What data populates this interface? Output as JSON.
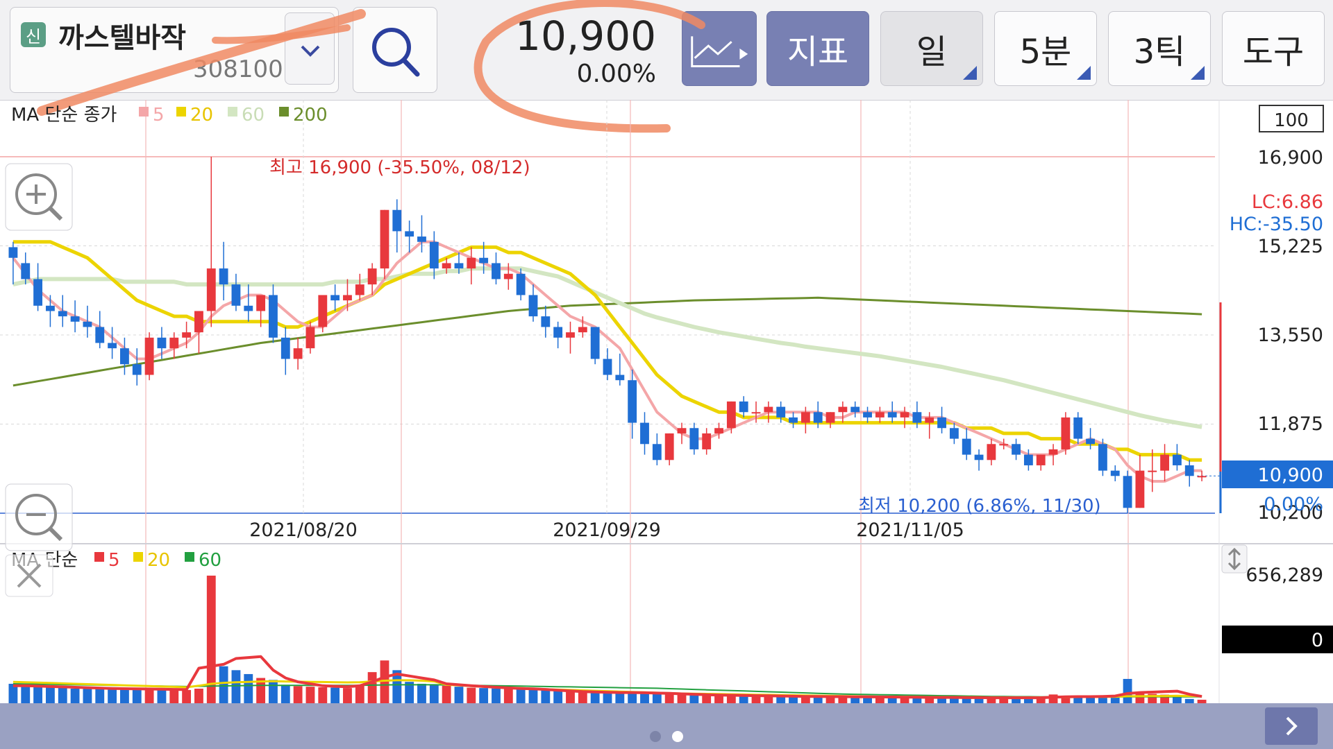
{
  "header": {
    "stock_badge": "신",
    "stock_name": "까스텔바작",
    "stock_code": "308100",
    "price": "10,900",
    "change_pct": "0.00%",
    "buttons": {
      "indicator": "지표",
      "day": "일",
      "min": "5분",
      "tick": "3틱",
      "tools": "도구"
    }
  },
  "colors": {
    "up": "#e8383d",
    "down": "#1f6ed4",
    "ma5": "#f4a6a8",
    "ma20": "#ecd400",
    "ma60": "#d3e6c2",
    "ma200": "#6b8e2c",
    "toolbar_blue": "#7880b3"
  },
  "price_panel": {
    "legend_prefix": "MA 단순 종가",
    "legend": [
      {
        "label": "5",
        "color": "#f4a6a8"
      },
      {
        "label": "20",
        "color": "#ecd400"
      },
      {
        "label": "60",
        "color": "#d3e6c2"
      },
      {
        "label": "200",
        "color": "#6b8e2c"
      }
    ],
    "zoom_box": "100",
    "lc": "LC:6.86",
    "hc": "HC:-35.50",
    "high_label": "최고 16,900 (-35.50%, 08/12)",
    "low_label": "최저 10,200 (6.86%, 11/30)",
    "last_price": "10,900",
    "last_pct": "0.00%",
    "y_labels": [
      "16,900",
      "15,225",
      "13,550",
      "11,875",
      "10,200"
    ],
    "x_labels": [
      "2021/08/20",
      "2021/09/29",
      "2021/11/05"
    ]
  },
  "volume_panel": {
    "legend_prefix": "MA 단순",
    "legend": [
      {
        "label": "5",
        "color": "#e8383d"
      },
      {
        "label": "20",
        "color": "#ecd400"
      },
      {
        "label": "60",
        "color": "#22a040"
      }
    ],
    "max_label": "656,289",
    "current": "0"
  },
  "icons": {
    "dropdown": "chevron-down-icon",
    "search": "search-icon",
    "chart_type": "line-chart-icon",
    "zoom_in": "zoom-in-icon",
    "zoom_out": "zoom-out-icon",
    "close": "close-icon",
    "resize": "resize-icon",
    "next": "chevron-right-icon"
  },
  "chart_data": {
    "type": "candlestick",
    "y_range": [
      10200,
      16900
    ],
    "candles_ohlc": [
      [
        15200,
        15300,
        14500,
        15000
      ],
      [
        14900,
        15100,
        14500,
        14600
      ],
      [
        14600,
        14900,
        14000,
        14100
      ],
      [
        14100,
        14300,
        13700,
        14000
      ],
      [
        14000,
        14300,
        13700,
        13900
      ],
      [
        13900,
        14200,
        13600,
        13800
      ],
      [
        13800,
        14100,
        13500,
        13700
      ],
      [
        13700,
        14000,
        13300,
        13400
      ],
      [
        13400,
        13700,
        13100,
        13300
      ],
      [
        13300,
        13500,
        12800,
        13000
      ],
      [
        13000,
        13300,
        12600,
        12800
      ],
      [
        12800,
        13600,
        12700,
        13500
      ],
      [
        13500,
        13700,
        13100,
        13300
      ],
      [
        13300,
        13600,
        13100,
        13500
      ],
      [
        13500,
        13800,
        13300,
        13600
      ],
      [
        13600,
        14000,
        13200,
        14000
      ],
      [
        14000,
        16900,
        13700,
        14800
      ],
      [
        14800,
        15300,
        14200,
        14500
      ],
      [
        14500,
        14700,
        14000,
        14100
      ],
      [
        14100,
        14500,
        13800,
        14000
      ],
      [
        14000,
        14300,
        13700,
        14300
      ],
      [
        14300,
        14500,
        13400,
        13500
      ],
      [
        13500,
        13700,
        12800,
        13100
      ],
      [
        13100,
        13500,
        12900,
        13300
      ],
      [
        13300,
        13800,
        13200,
        13700
      ],
      [
        13700,
        14200,
        13600,
        14300
      ],
      [
        14300,
        14500,
        14000,
        14200
      ],
      [
        14200,
        14600,
        14000,
        14300
      ],
      [
        14300,
        14700,
        14200,
        14500
      ],
      [
        14500,
        14900,
        14300,
        14800
      ],
      [
        14800,
        15900,
        14600,
        15900
      ],
      [
        15900,
        16100,
        15100,
        15500
      ],
      [
        15500,
        15700,
        15100,
        15400
      ],
      [
        15400,
        15800,
        15100,
        15300
      ],
      [
        15300,
        15500,
        14600,
        14800
      ],
      [
        14800,
        15000,
        14700,
        14900
      ],
      [
        14900,
        15100,
        14700,
        14800
      ],
      [
        14800,
        15200,
        14500,
        15000
      ],
      [
        15000,
        15300,
        14700,
        14900
      ],
      [
        14900,
        15100,
        14500,
        14600
      ],
      [
        14600,
        14900,
        14400,
        14700
      ],
      [
        14700,
        14800,
        14200,
        14300
      ],
      [
        14300,
        14500,
        13800,
        13900
      ],
      [
        13900,
        14100,
        13500,
        13700
      ],
      [
        13700,
        13800,
        13300,
        13500
      ],
      [
        13500,
        13800,
        13200,
        13600
      ],
      [
        13600,
        13900,
        13500,
        13700
      ],
      [
        13700,
        13700,
        13000,
        13100
      ],
      [
        13100,
        13300,
        12700,
        12800
      ],
      [
        12800,
        13200,
        12600,
        12700
      ],
      [
        12700,
        12900,
        11600,
        11900
      ],
      [
        11900,
        12100,
        11300,
        11500
      ],
      [
        11500,
        11700,
        11100,
        11200
      ],
      [
        11200,
        11700,
        11100,
        11700
      ],
      [
        11700,
        11900,
        11500,
        11800
      ],
      [
        11800,
        11900,
        11300,
        11400
      ],
      [
        11400,
        11800,
        11300,
        11700
      ],
      [
        11700,
        11900,
        11600,
        11800
      ],
      [
        11800,
        12300,
        11700,
        12300
      ],
      [
        12300,
        12400,
        12000,
        12100
      ],
      [
        12100,
        12300,
        11900,
        12100
      ],
      [
        12100,
        12300,
        11900,
        12200
      ],
      [
        12200,
        12300,
        11900,
        12000
      ],
      [
        12000,
        12100,
        11800,
        11900
      ],
      [
        11900,
        12200,
        11700,
        12100
      ],
      [
        12100,
        12300,
        11800,
        11900
      ],
      [
        11900,
        12100,
        11800,
        12100
      ],
      [
        12100,
        12300,
        11900,
        12200
      ],
      [
        12200,
        12300,
        12000,
        12100
      ],
      [
        12100,
        12200,
        11900,
        12000
      ],
      [
        12000,
        12200,
        11900,
        12100
      ],
      [
        12100,
        12300,
        11900,
        12000
      ],
      [
        12000,
        12200,
        11800,
        12100
      ],
      [
        12100,
        12300,
        11800,
        11900
      ],
      [
        11900,
        12100,
        11600,
        12000
      ],
      [
        12000,
        12200,
        11700,
        11800
      ],
      [
        11800,
        11900,
        11500,
        11600
      ],
      [
        11600,
        11800,
        11200,
        11300
      ],
      [
        11300,
        11400,
        11000,
        11200
      ],
      [
        11200,
        11600,
        11100,
        11500
      ],
      [
        11500,
        11600,
        11400,
        11500
      ],
      [
        11500,
        11600,
        11200,
        11300
      ],
      [
        11300,
        11400,
        11000,
        11100
      ],
      [
        11100,
        11300,
        11000,
        11300
      ],
      [
        11300,
        11500,
        11100,
        11400
      ],
      [
        11400,
        12100,
        11300,
        12000
      ],
      [
        12000,
        12100,
        11500,
        11600
      ],
      [
        11600,
        11800,
        11400,
        11500
      ],
      [
        11500,
        11600,
        10900,
        11000
      ],
      [
        11000,
        11100,
        10800,
        10900
      ],
      [
        10900,
        11000,
        10200,
        10300
      ],
      [
        10300,
        11300,
        10300,
        11000
      ],
      [
        11000,
        11400,
        10600,
        11000
      ],
      [
        11000,
        11500,
        10800,
        11300
      ],
      [
        11300,
        11500,
        11000,
        11100
      ],
      [
        11100,
        11200,
        10700,
        10900
      ],
      [
        10900,
        11000,
        10800,
        10900
      ]
    ],
    "ma5": [
      15000,
      14700,
      14400,
      14200,
      14000,
      13900,
      13800,
      13700,
      13500,
      13300,
      13100,
      13100,
      13200,
      13300,
      13400,
      13600,
      13900,
      14100,
      14200,
      14300,
      14300,
      14200,
      14000,
      13800,
      13700,
      13700,
      13900,
      14100,
      14200,
      14300,
      14600,
      14900,
      15100,
      15300,
      15300,
      15200,
      15100,
      15000,
      14900,
      14800,
      14800,
      14700,
      14500,
      14300,
      14100,
      13900,
      13800,
      13700,
      13500,
      13300,
      12900,
      12500,
      12100,
      11900,
      11700,
      11600,
      11600,
      11700,
      11800,
      11900,
      12000,
      12100,
      12100,
      12100,
      12100,
      12100,
      12000,
      12000,
      12100,
      12100,
      12100,
      12100,
      12100,
      12000,
      12000,
      12000,
      11900,
      11800,
      11700,
      11600,
      11500,
      11400,
      11300,
      11300,
      11300,
      11400,
      11500,
      11600,
      11500,
      11400,
      11100,
      10900,
      10800,
      10800,
      10900,
      11000,
      11000
    ],
    "ma20": [
      15300,
      15300,
      15300,
      15300,
      15200,
      15100,
      15000,
      14800,
      14600,
      14400,
      14200,
      14100,
      14000,
      13900,
      13900,
      13800,
      13800,
      13800,
      13800,
      13800,
      13800,
      13800,
      13700,
      13700,
      13800,
      13900,
      14000,
      14100,
      14200,
      14300,
      14500,
      14600,
      14700,
      14800,
      14900,
      15000,
      15100,
      15200,
      15200,
      15200,
      15100,
      15100,
      15000,
      14900,
      14800,
      14700,
      14500,
      14300,
      14000,
      13700,
      13400,
      13100,
      12800,
      12600,
      12400,
      12300,
      12200,
      12100,
      12100,
      12000,
      12000,
      12000,
      12000,
      11900,
      11900,
      11900,
      11900,
      11900,
      11900,
      11900,
      11900,
      11900,
      11900,
      11900,
      11900,
      11900,
      11900,
      11800,
      11800,
      11800,
      11700,
      11700,
      11700,
      11600,
      11600,
      11600,
      11500,
      11500,
      11500,
      11400,
      11400,
      11300,
      11300,
      11300,
      11300,
      11200,
      11200
    ],
    "ma60": [
      14500,
      14550,
      14600,
      14600,
      14600,
      14600,
      14600,
      14600,
      14600,
      14550,
      14550,
      14550,
      14550,
      14550,
      14500,
      14500,
      14500,
      14500,
      14500,
      14500,
      14500,
      14500,
      14500,
      14500,
      14500,
      14500,
      14550,
      14550,
      14550,
      14600,
      14600,
      14650,
      14700,
      14700,
      14700,
      14750,
      14750,
      14800,
      14800,
      14800,
      14800,
      14800,
      14750,
      14700,
      14650,
      14550,
      14450,
      14350,
      14250,
      14150,
      14050,
      13950,
      13880,
      13820,
      13760,
      13700,
      13650,
      13600,
      13560,
      13520,
      13480,
      13440,
      13400,
      13370,
      13330,
      13300,
      13270,
      13240,
      13210,
      13180,
      13150,
      13110,
      13070,
      13030,
      12990,
      12950,
      12900,
      12850,
      12800,
      12750,
      12700,
      12640,
      12580,
      12520,
      12460,
      12400,
      12340,
      12280,
      12220,
      12160,
      12100,
      12040,
      11990,
      11940,
      11900,
      11860,
      11820
    ],
    "ma200": [
      12600,
      12640,
      12680,
      12720,
      12760,
      12800,
      12840,
      12880,
      12920,
      12960,
      13000,
      13040,
      13080,
      13120,
      13160,
      13200,
      13240,
      13280,
      13320,
      13360,
      13400,
      13430,
      13460,
      13490,
      13520,
      13550,
      13580,
      13610,
      13640,
      13670,
      13700,
      13730,
      13760,
      13790,
      13820,
      13850,
      13880,
      13910,
      13940,
      13970,
      14000,
      14020,
      14040,
      14060,
      14080,
      14100,
      14110,
      14120,
      14130,
      14140,
      14150,
      14160,
      14170,
      14180,
      14190,
      14200,
      14205,
      14210,
      14215,
      14220,
      14225,
      14230,
      14235,
      14240,
      14245,
      14250,
      14240,
      14230,
      14220,
      14210,
      14200,
      14190,
      14180,
      14170,
      14160,
      14150,
      14140,
      14130,
      14120,
      14110,
      14100,
      14090,
      14080,
      14070,
      14060,
      14050,
      14040,
      14030,
      14020,
      14010,
      14000,
      13990,
      13980,
      13970,
      13960,
      13950,
      13940
    ],
    "volume_max": 656289,
    "volume": [
      100000,
      95000,
      90000,
      85000,
      80000,
      75000,
      78000,
      82000,
      80000,
      76000,
      74000,
      70000,
      72000,
      70000,
      68000,
      75000,
      656289,
      190000,
      170000,
      150000,
      130000,
      120000,
      95000,
      88000,
      85000,
      82000,
      80000,
      78000,
      92000,
      160000,
      220000,
      170000,
      110000,
      100000,
      95000,
      90000,
      85000,
      80000,
      78000,
      76000,
      75000,
      74000,
      70000,
      66000,
      62000,
      60000,
      58000,
      56000,
      54000,
      52000,
      60000,
      55000,
      50000,
      48000,
      45000,
      44000,
      43000,
      42000,
      41000,
      40000,
      39000,
      38000,
      37000,
      36000,
      35000,
      35000,
      34000,
      34000,
      33000,
      33000,
      32000,
      32000,
      31000,
      31000,
      30000,
      30000,
      30000,
      29000,
      29000,
      28000,
      28000,
      28000,
      27000,
      27000,
      45000,
      38000,
      32000,
      30000,
      32000,
      40000,
      125000,
      55000,
      48000,
      44000,
      40000,
      22000,
      18000
    ],
    "vol_ma5": [
      90000,
      90000,
      88000,
      86000,
      84000,
      82000,
      80000,
      78000,
      76000,
      75000,
      74000,
      73000,
      72000,
      71000,
      70000,
      180000,
      190000,
      200000,
      230000,
      235000,
      240000,
      170000,
      130000,
      110000,
      100000,
      90000,
      87000,
      85000,
      90000,
      110000,
      135000,
      150000,
      140000,
      130000,
      120000,
      100000,
      95000,
      90000,
      86000,
      82000,
      79000,
      76000,
      74000,
      71000,
      67000,
      63000,
      60000,
      58000,
      56000,
      55000,
      55000,
      54000,
      52000,
      51000,
      48000,
      46000,
      44000,
      42000,
      41000,
      40000,
      39000,
      38000,
      37000,
      36000,
      35000,
      35000,
      34000,
      34000,
      33000,
      33000,
      32000,
      32000,
      31000,
      31000,
      30000,
      30000,
      30000,
      29000,
      29000,
      28000,
      28000,
      28000,
      28000,
      28000,
      31000,
      33000,
      34000,
      34000,
      35000,
      37000,
      50000,
      55000,
      57000,
      60000,
      62000,
      46000,
      35000
    ],
    "vol_ma20": [
      110000,
      108000,
      106000,
      104000,
      102000,
      100000,
      98000,
      96000,
      94000,
      92000,
      90000,
      88000,
      86000,
      84000,
      82000,
      90000,
      100000,
      105000,
      108000,
      110000,
      112000,
      113000,
      112000,
      111000,
      110000,
      109000,
      108000,
      107000,
      108000,
      112000,
      116000,
      118000,
      118000,
      116000,
      112000,
      95000,
      92000,
      88000,
      85000,
      82000,
      80000,
      78000,
      75000,
      72000,
      70000,
      68000,
      66000,
      64000,
      62000,
      60000,
      58000,
      56000,
      54000,
      52000,
      50000,
      49000,
      48000,
      47000,
      46000,
      45000,
      44000,
      43000,
      42000,
      41000,
      40000,
      39000,
      38000,
      37000,
      36000,
      35000,
      34000,
      34000,
      33000,
      33000,
      32000,
      32000,
      31000,
      31000,
      31000,
      30000,
      30000,
      30000,
      30000,
      30000,
      31000,
      31000,
      32000,
      32000,
      33000,
      33000,
      36000,
      36000,
      37000,
      37000,
      38000,
      37000,
      36000
    ],
    "vol_ma60": [
      100000,
      99000,
      98000,
      97000,
      96000,
      95000,
      94000,
      93000,
      92000,
      91000,
      90000,
      89000,
      88000,
      87000,
      86000,
      87000,
      88000,
      89000,
      90000,
      91000,
      92000,
      92000,
      92000,
      92000,
      92000,
      92000,
      92000,
      92000,
      92000,
      93000,
      94000,
      95000,
      95000,
      95000,
      95000,
      94000,
      93000,
      92000,
      91000,
      90000,
      89000,
      88000,
      87000,
      86000,
      85000,
      84000,
      83000,
      82000,
      81000,
      80000,
      79000,
      78000,
      77000,
      75000,
      73000,
      71000,
      69000,
      67000,
      65000,
      63000,
      61000,
      59000,
      57000,
      55000,
      53000,
      51000,
      49000,
      47000,
      46000,
      45000,
      44000,
      43000,
      42000,
      41000,
      40000,
      39000,
      38000,
      37000,
      36000,
      35000,
      35000,
      34000,
      34000,
      33000,
      33000,
      33000,
      32000,
      32000,
      32000,
      32000,
      33000,
      33000,
      33000,
      33000,
      33000,
      33000,
      33000
    ]
  }
}
